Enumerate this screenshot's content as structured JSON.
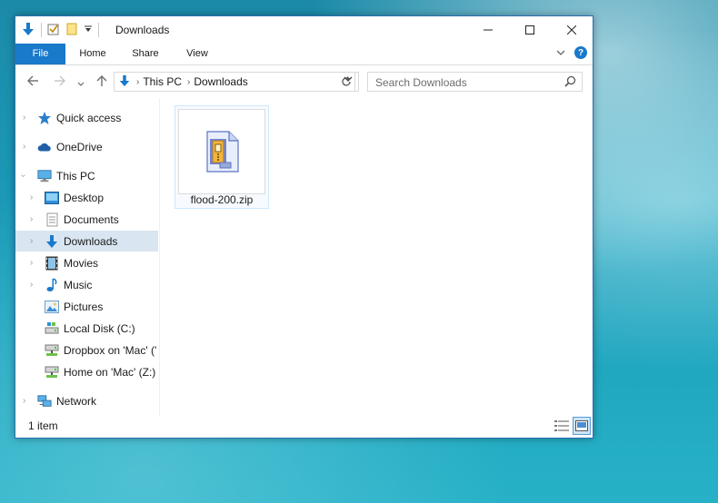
{
  "window": {
    "title": "Downloads"
  },
  "ribbon": {
    "tabs": [
      "File",
      "Home",
      "Share",
      "View"
    ]
  },
  "address": {
    "segments": [
      "This PC",
      "Downloads"
    ]
  },
  "search": {
    "placeholder": "Search Downloads"
  },
  "nav": {
    "items": [
      {
        "label": "Quick access",
        "icon": "star-icon"
      },
      {
        "label": "OneDrive",
        "icon": "cloud-icon"
      },
      {
        "label": "This PC",
        "icon": "computer-icon"
      },
      {
        "label": "Desktop",
        "icon": "desktop-folder-icon"
      },
      {
        "label": "Documents",
        "icon": "documents-folder-icon"
      },
      {
        "label": "Downloads",
        "icon": "download-arrow-icon"
      },
      {
        "label": "Movies",
        "icon": "film-icon"
      },
      {
        "label": "Music",
        "icon": "music-note-icon"
      },
      {
        "label": "Pictures",
        "icon": "pictures-folder-icon"
      },
      {
        "label": "Local Disk (C:)",
        "icon": "drive-icon"
      },
      {
        "label": "Dropbox on 'Mac' ('",
        "icon": "network-drive-icon"
      },
      {
        "label": "Home on 'Mac' (Z:)",
        "icon": "network-drive-icon"
      },
      {
        "label": "Network",
        "icon": "network-icon"
      }
    ]
  },
  "files": [
    {
      "name": "flood-200.zip",
      "icon": "zip-archive-icon"
    }
  ],
  "status": {
    "text": "1 item"
  },
  "colors": {
    "accent": "#1979ca",
    "selection": "#d9e6f1",
    "window_border": "#2b6fb2"
  }
}
